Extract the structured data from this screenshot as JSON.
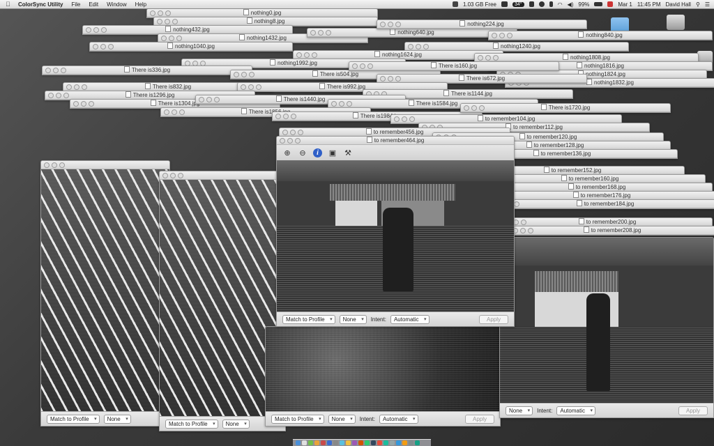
{
  "menubar": {
    "apple": "",
    "app_name": "ColorSync Utility",
    "menus": [
      "File",
      "Edit",
      "Window",
      "Help"
    ],
    "memory": "1.03 GB Free",
    "temperature": "34°",
    "battery": "99%",
    "date": "Mar 1",
    "time": "11:45 PM",
    "user": "David Hall"
  },
  "front_window": {
    "title": "to remember464.jpg",
    "match_label": "Match to Profile",
    "profile_value": "None",
    "intent_label": "Intent:",
    "intent_value": "Automatic",
    "apply_label": "Apply"
  },
  "window_titles": [
    "nothing0.jpg",
    "nothing8.jpg",
    "nothing432.jpg",
    "nothing1432.jpg",
    "nothing1040.jpg",
    "nothing640.jpg",
    "nothing224.jpg",
    "nothing1240.jpg",
    "nothing840.jpg",
    "nothing1624.jpg",
    "nothing1992.jpg",
    "nothing1808.jpg",
    "nothing1816.jpg",
    "nothing1824.jpg",
    "nothing1832.jpg",
    "There is336.jpg",
    "There is504.jpg",
    "There is160.jpg",
    "There is832.jpg",
    "There is672.jpg",
    "There is992.jpg",
    "There is1144.jpg",
    "There is1296.jpg",
    "There is1304.jpg",
    "There is1440.jpg",
    "There is1584.jpg",
    "There is1856.jpg",
    "There is1984.jpg",
    "There is1720.jpg",
    "to remember104.jpg",
    "to remember112.jpg",
    "to remember456.jpg",
    "to remember120.jpg",
    "to remember128.jpg",
    "to remember136.jpg",
    "to remember152.jpg",
    "to remember160.jpg",
    "to remember168.jpg",
    "to remember176.jpg",
    "to remember184.jpg",
    "to remember200.jpg",
    "to remember208.jpg"
  ],
  "bottom_labels": {
    "match": "Match to Profile",
    "none": "None",
    "intent": "Intent:",
    "automatic": "Automatic",
    "apply": "Apply"
  }
}
